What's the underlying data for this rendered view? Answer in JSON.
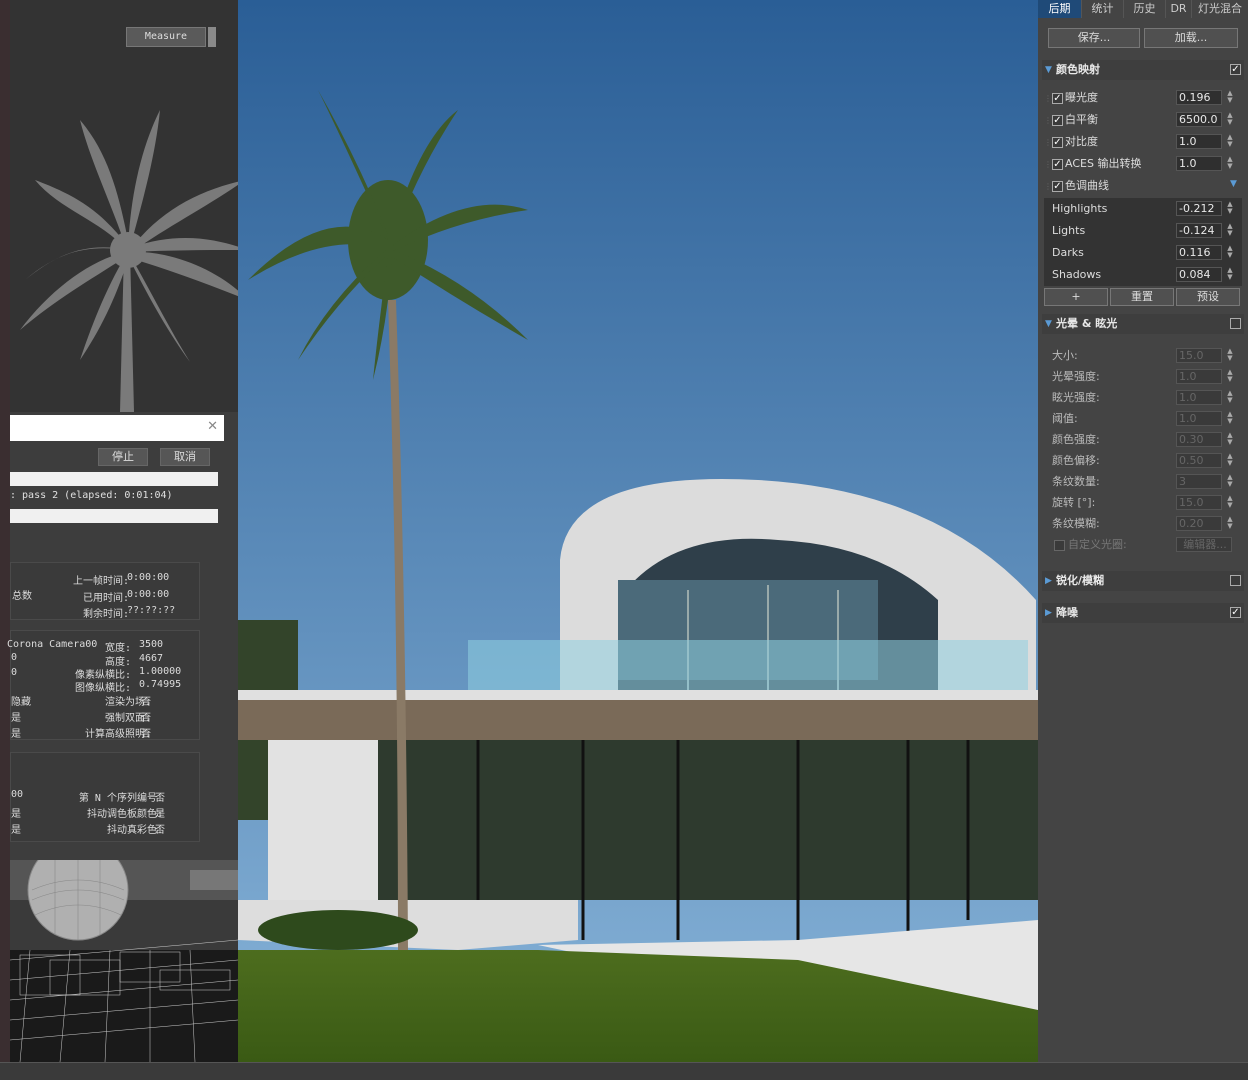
{
  "left": {
    "measure_label": "Measure",
    "stop_label": "停止",
    "cancel_label": "取消",
    "pass_text": ": pass 2 (elapsed: 0:01:04)",
    "time_rows": [
      {
        "label": "上一帧时间:",
        "value": "0:00:00"
      },
      {
        "label": "已用时间:",
        "value": "0:00:00"
      },
      {
        "label": "剩余时间:",
        "value": "??:??:??"
      }
    ],
    "total_label": "总数",
    "camera_info": {
      "camera": "Corona Camera00",
      "rows": [
        {
          "label": "宽度:",
          "value": "3500"
        },
        {
          "label": "高度:",
          "value": "4667"
        },
        {
          "label": "像素纵横比:",
          "value": "1.00000"
        },
        {
          "label": "图像纵横比:",
          "value": "0.74995"
        },
        {
          "label": "渲染为场:",
          "value": "否"
        },
        {
          "label": "强制双面:",
          "value": "否"
        },
        {
          "label": "计算高级照明:",
          "value": "否"
        }
      ],
      "left_fragments": [
        "0",
        "0",
        "隐藏",
        "是",
        "是"
      ]
    },
    "seq_info": {
      "rows": [
        {
          "label": "第 N 个序列编号:",
          "value": "否"
        },
        {
          "label": "抖动调色板颜色:",
          "value": "是"
        },
        {
          "label": "抖动真彩色:",
          "value": "否"
        }
      ],
      "left_fragments": [
        "00",
        "是",
        "是"
      ]
    }
  },
  "right": {
    "tabs": [
      "后期",
      "统计",
      "历史",
      "DR",
      "灯光混合"
    ],
    "save_label": "保存...",
    "load_label": "加载...",
    "tonemap": {
      "title": "颜色映射",
      "rows": [
        {
          "label": "曝光度",
          "value": "0.196",
          "checked": true
        },
        {
          "label": "白平衡",
          "value": "6500.0",
          "checked": true
        },
        {
          "label": "对比度",
          "value": "1.0",
          "checked": true
        },
        {
          "label": "ACES 输出转换",
          "value": "1.0",
          "checked": true
        }
      ],
      "curve_label": "色调曲线",
      "curve_rows": [
        {
          "label": "Highlights",
          "value": "-0.212"
        },
        {
          "label": "Lights",
          "value": "-0.124"
        },
        {
          "label": "Darks",
          "value": "0.116"
        },
        {
          "label": "Shadows",
          "value": "0.084"
        }
      ],
      "add_label": "+",
      "reset_label": "重置",
      "preset_label": "预设"
    },
    "bloom": {
      "title": "光晕 & 眩光",
      "rows": [
        {
          "label": "大小:",
          "value": "15.0"
        },
        {
          "label": "光晕强度:",
          "value": "1.0"
        },
        {
          "label": "眩光强度:",
          "value": "1.0"
        },
        {
          "label": "阈值:",
          "value": "1.0"
        },
        {
          "label": "颜色强度:",
          "value": "0.30"
        },
        {
          "label": "颜色偏移:",
          "value": "0.50"
        },
        {
          "label": "条纹数量:",
          "value": "3"
        },
        {
          "label": "旋转 [°]:",
          "value": "15.0"
        },
        {
          "label": "条纹模糊:",
          "value": "0.20"
        }
      ],
      "custom_label": "自定义光圈:",
      "edit_label": "编辑器..."
    },
    "sharpen_title": "锐化/模糊",
    "denoise_title": "降噪"
  },
  "colors": {
    "tab_active": "#1f4a78",
    "accent_blue": "#5b9bd5",
    "sky_top": "#2a5e96",
    "sky_bottom": "#87b3d8"
  }
}
